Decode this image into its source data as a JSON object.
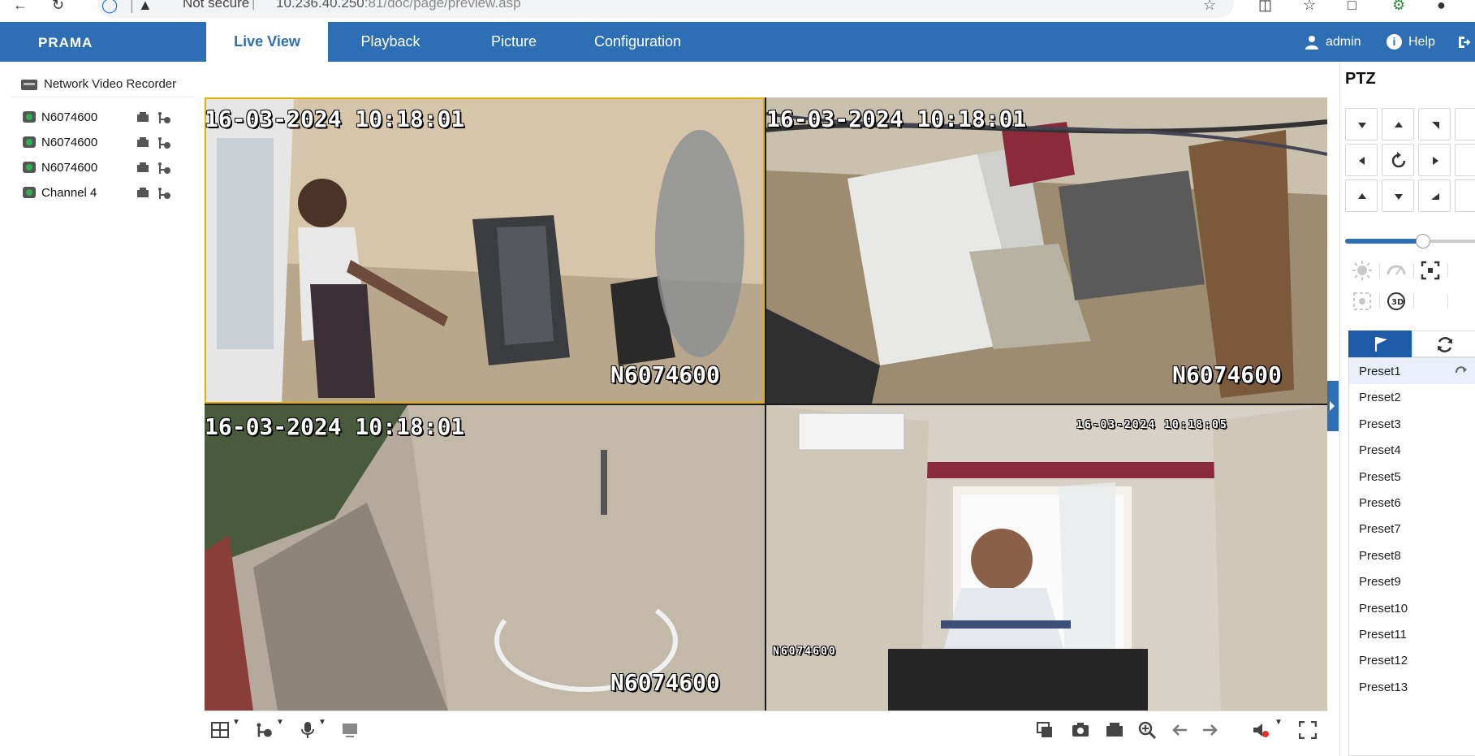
{
  "browser": {
    "security_text": "Not secure",
    "separator": "|",
    "url_host": "10.236.40.250",
    "url_rest": ":81/doc/page/preview.asp"
  },
  "header": {
    "logo": "PRAMA",
    "tabs": [
      {
        "label": "Live View",
        "active": true
      },
      {
        "label": "Playback",
        "active": false
      },
      {
        "label": "Picture",
        "active": false
      },
      {
        "label": "Configuration",
        "active": false
      }
    ],
    "user": "admin",
    "help": "Help",
    "accent_color": "#2d6eb5"
  },
  "device_tree": {
    "root_label": "Network Video Recorder",
    "channels": [
      {
        "label": "N6074600"
      },
      {
        "label": "N6074600"
      },
      {
        "label": "N6074600"
      },
      {
        "label": "Channel 4"
      }
    ]
  },
  "video_tiles": [
    {
      "timestamp": "16-03-2024 10:18:01",
      "name": "N6074600",
      "selected": true
    },
    {
      "timestamp": "16-03-2024 10:18:01",
      "name": "N6074600",
      "selected": false
    },
    {
      "timestamp": "16-03-2024 10:18:01",
      "name": "N6074600",
      "selected": false
    },
    {
      "timestamp": "16-03-2024 10:18:05",
      "name": "N6074600",
      "selected": false
    }
  ],
  "ptz": {
    "title": "PTZ",
    "speed_fraction": 0.6,
    "presets": [
      "Preset1",
      "Preset2",
      "Preset3",
      "Preset4",
      "Preset5",
      "Preset6",
      "Preset7",
      "Preset8",
      "Preset9",
      "Preset10",
      "Preset11",
      "Preset12",
      "Preset13"
    ]
  },
  "icons": {
    "toolbar_left": [
      "window-layout-icon",
      "stream-icon",
      "microphone-icon",
      "device-icon"
    ],
    "toolbar_right": [
      "close-all-icon",
      "snapshot-icon",
      "record-icon",
      "digital-zoom-icon",
      "previous-page-icon",
      "next-page-icon",
      "volume-muted-icon",
      "fullscreen-icon"
    ]
  }
}
